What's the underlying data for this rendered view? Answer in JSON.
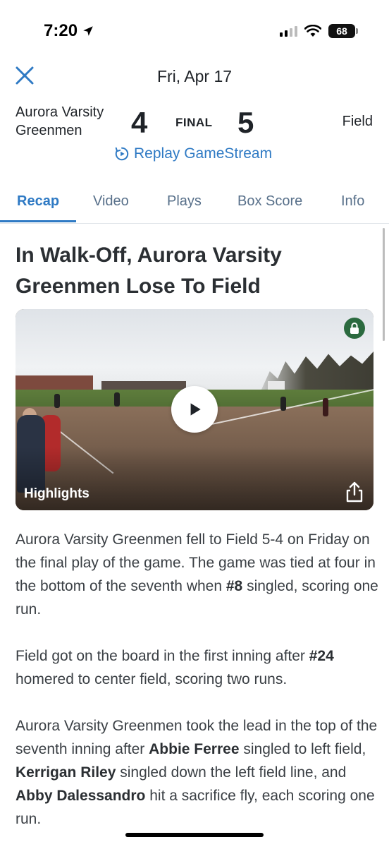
{
  "status_bar": {
    "time": "7:20",
    "battery": "68"
  },
  "header": {
    "date": "Fri, Apr 17"
  },
  "scoreboard": {
    "home_team": "Aurora Varsity Greenmen",
    "home_score": "4",
    "status": "FINAL",
    "away_score": "5",
    "away_team": "Field",
    "replay_label": "Replay GameStream"
  },
  "tabs": [
    {
      "label": "Recap",
      "active": true
    },
    {
      "label": "Video"
    },
    {
      "label": "Plays"
    },
    {
      "label": "Box Score"
    },
    {
      "label": "Info"
    }
  ],
  "article": {
    "headline": "In Walk-Off, Aurora Varsity Greenmen Lose To Field",
    "video_label": "Highlights",
    "p1_a": "Aurora Varsity Greenmen fell to Field 5-4 on Friday on the final play of the game. The game was tied at four in the bottom of the seventh when ",
    "p1_b": "#8",
    "p1_c": " singled, scoring one run.",
    "p2_a": "Field got on the board in the first inning after ",
    "p2_b": "#24",
    "p2_c": " homered to center field, scoring two runs.",
    "p3_a": "Aurora Varsity Greenmen took the lead in the top of the seventh inning after ",
    "p3_b": "Abbie Ferree",
    "p3_c": " singled to left field, ",
    "p3_d": "Kerrigan Riley",
    "p3_e": " singled down the left field line, and ",
    "p3_f": "Abby Dalessandro",
    "p3_g": " hit a sacrifice fly, each scoring one run."
  },
  "colors": {
    "accent": "#2f7ac4",
    "lock_badge": "#2b6a3f"
  }
}
